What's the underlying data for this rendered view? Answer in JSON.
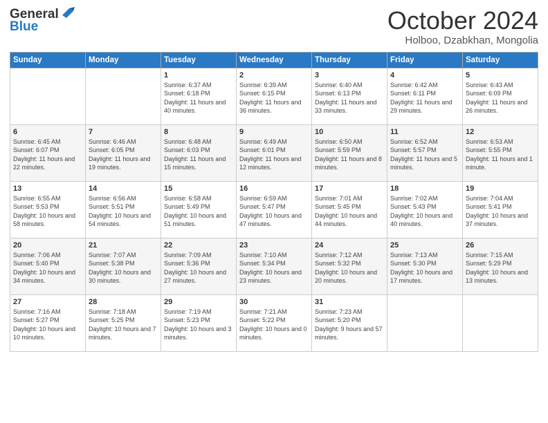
{
  "header": {
    "logo_line1": "General",
    "logo_line2": "Blue",
    "month_title": "October 2024",
    "location": "Holboo, Dzabkhan, Mongolia"
  },
  "days_of_week": [
    "Sunday",
    "Monday",
    "Tuesday",
    "Wednesday",
    "Thursday",
    "Friday",
    "Saturday"
  ],
  "weeks": [
    [
      {
        "day": "",
        "sunrise": "",
        "sunset": "",
        "daylight": ""
      },
      {
        "day": "",
        "sunrise": "",
        "sunset": "",
        "daylight": ""
      },
      {
        "day": "1",
        "sunrise": "Sunrise: 6:37 AM",
        "sunset": "Sunset: 6:18 PM",
        "daylight": "Daylight: 11 hours and 40 minutes."
      },
      {
        "day": "2",
        "sunrise": "Sunrise: 6:39 AM",
        "sunset": "Sunset: 6:15 PM",
        "daylight": "Daylight: 11 hours and 36 minutes."
      },
      {
        "day": "3",
        "sunrise": "Sunrise: 6:40 AM",
        "sunset": "Sunset: 6:13 PM",
        "daylight": "Daylight: 11 hours and 33 minutes."
      },
      {
        "day": "4",
        "sunrise": "Sunrise: 6:42 AM",
        "sunset": "Sunset: 6:11 PM",
        "daylight": "Daylight: 11 hours and 29 minutes."
      },
      {
        "day": "5",
        "sunrise": "Sunrise: 6:43 AM",
        "sunset": "Sunset: 6:09 PM",
        "daylight": "Daylight: 11 hours and 26 minutes."
      }
    ],
    [
      {
        "day": "6",
        "sunrise": "Sunrise: 6:45 AM",
        "sunset": "Sunset: 6:07 PM",
        "daylight": "Daylight: 11 hours and 22 minutes."
      },
      {
        "day": "7",
        "sunrise": "Sunrise: 6:46 AM",
        "sunset": "Sunset: 6:05 PM",
        "daylight": "Daylight: 11 hours and 19 minutes."
      },
      {
        "day": "8",
        "sunrise": "Sunrise: 6:48 AM",
        "sunset": "Sunset: 6:03 PM",
        "daylight": "Daylight: 11 hours and 15 minutes."
      },
      {
        "day": "9",
        "sunrise": "Sunrise: 6:49 AM",
        "sunset": "Sunset: 6:01 PM",
        "daylight": "Daylight: 11 hours and 12 minutes."
      },
      {
        "day": "10",
        "sunrise": "Sunrise: 6:50 AM",
        "sunset": "Sunset: 5:59 PM",
        "daylight": "Daylight: 11 hours and 8 minutes."
      },
      {
        "day": "11",
        "sunrise": "Sunrise: 6:52 AM",
        "sunset": "Sunset: 5:57 PM",
        "daylight": "Daylight: 11 hours and 5 minutes."
      },
      {
        "day": "12",
        "sunrise": "Sunrise: 6:53 AM",
        "sunset": "Sunset: 5:55 PM",
        "daylight": "Daylight: 11 hours and 1 minute."
      }
    ],
    [
      {
        "day": "13",
        "sunrise": "Sunrise: 6:55 AM",
        "sunset": "Sunset: 5:53 PM",
        "daylight": "Daylight: 10 hours and 58 minutes."
      },
      {
        "day": "14",
        "sunrise": "Sunrise: 6:56 AM",
        "sunset": "Sunset: 5:51 PM",
        "daylight": "Daylight: 10 hours and 54 minutes."
      },
      {
        "day": "15",
        "sunrise": "Sunrise: 6:58 AM",
        "sunset": "Sunset: 5:49 PM",
        "daylight": "Daylight: 10 hours and 51 minutes."
      },
      {
        "day": "16",
        "sunrise": "Sunrise: 6:59 AM",
        "sunset": "Sunset: 5:47 PM",
        "daylight": "Daylight: 10 hours and 47 minutes."
      },
      {
        "day": "17",
        "sunrise": "Sunrise: 7:01 AM",
        "sunset": "Sunset: 5:45 PM",
        "daylight": "Daylight: 10 hours and 44 minutes."
      },
      {
        "day": "18",
        "sunrise": "Sunrise: 7:02 AM",
        "sunset": "Sunset: 5:43 PM",
        "daylight": "Daylight: 10 hours and 40 minutes."
      },
      {
        "day": "19",
        "sunrise": "Sunrise: 7:04 AM",
        "sunset": "Sunset: 5:41 PM",
        "daylight": "Daylight: 10 hours and 37 minutes."
      }
    ],
    [
      {
        "day": "20",
        "sunrise": "Sunrise: 7:06 AM",
        "sunset": "Sunset: 5:40 PM",
        "daylight": "Daylight: 10 hours and 34 minutes."
      },
      {
        "day": "21",
        "sunrise": "Sunrise: 7:07 AM",
        "sunset": "Sunset: 5:38 PM",
        "daylight": "Daylight: 10 hours and 30 minutes."
      },
      {
        "day": "22",
        "sunrise": "Sunrise: 7:09 AM",
        "sunset": "Sunset: 5:36 PM",
        "daylight": "Daylight: 10 hours and 27 minutes."
      },
      {
        "day": "23",
        "sunrise": "Sunrise: 7:10 AM",
        "sunset": "Sunset: 5:34 PM",
        "daylight": "Daylight: 10 hours and 23 minutes."
      },
      {
        "day": "24",
        "sunrise": "Sunrise: 7:12 AM",
        "sunset": "Sunset: 5:32 PM",
        "daylight": "Daylight: 10 hours and 20 minutes."
      },
      {
        "day": "25",
        "sunrise": "Sunrise: 7:13 AM",
        "sunset": "Sunset: 5:30 PM",
        "daylight": "Daylight: 10 hours and 17 minutes."
      },
      {
        "day": "26",
        "sunrise": "Sunrise: 7:15 AM",
        "sunset": "Sunset: 5:29 PM",
        "daylight": "Daylight: 10 hours and 13 minutes."
      }
    ],
    [
      {
        "day": "27",
        "sunrise": "Sunrise: 7:16 AM",
        "sunset": "Sunset: 5:27 PM",
        "daylight": "Daylight: 10 hours and 10 minutes."
      },
      {
        "day": "28",
        "sunrise": "Sunrise: 7:18 AM",
        "sunset": "Sunset: 5:25 PM",
        "daylight": "Daylight: 10 hours and 7 minutes."
      },
      {
        "day": "29",
        "sunrise": "Sunrise: 7:19 AM",
        "sunset": "Sunset: 5:23 PM",
        "daylight": "Daylight: 10 hours and 3 minutes."
      },
      {
        "day": "30",
        "sunrise": "Sunrise: 7:21 AM",
        "sunset": "Sunset: 5:22 PM",
        "daylight": "Daylight: 10 hours and 0 minutes."
      },
      {
        "day": "31",
        "sunrise": "Sunrise: 7:23 AM",
        "sunset": "Sunset: 5:20 PM",
        "daylight": "Daylight: 9 hours and 57 minutes."
      },
      {
        "day": "",
        "sunrise": "",
        "sunset": "",
        "daylight": ""
      },
      {
        "day": "",
        "sunrise": "",
        "sunset": "",
        "daylight": ""
      }
    ]
  ]
}
